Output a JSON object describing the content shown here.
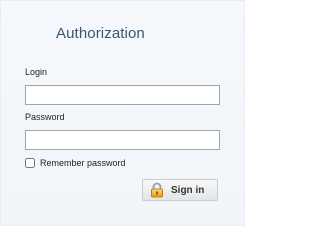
{
  "auth": {
    "title": "Authorization",
    "login_label": "Login",
    "login_value": "",
    "password_label": "Password",
    "password_value": "",
    "remember_label": "Remember password",
    "remember_checked": false,
    "signin_label": "Sign in",
    "signin_icon": "lock-icon"
  }
}
